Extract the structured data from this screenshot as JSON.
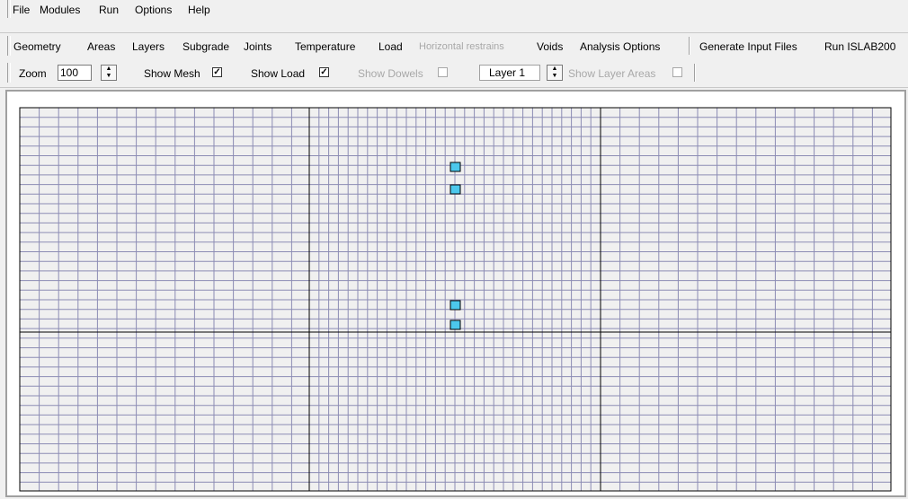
{
  "menu": {
    "items": [
      {
        "label": "File"
      },
      {
        "label": "Modules"
      },
      {
        "label": "Run"
      },
      {
        "label": "Options"
      },
      {
        "label": "Help"
      }
    ]
  },
  "toolbar1": {
    "items": [
      {
        "label": "Geometry",
        "enabled": true
      },
      {
        "label": "Areas",
        "enabled": true
      },
      {
        "label": "Layers",
        "enabled": true
      },
      {
        "label": "Subgrade",
        "enabled": true
      },
      {
        "label": "Joints",
        "enabled": true
      },
      {
        "label": "Temperature",
        "enabled": true
      },
      {
        "label": "Load",
        "enabled": true
      },
      {
        "label": "Horizontal restrains",
        "enabled": false
      },
      {
        "label": "Voids",
        "enabled": true
      },
      {
        "label": "Analysis Options",
        "enabled": true
      }
    ],
    "right_items": [
      {
        "label": "Generate Input Files"
      },
      {
        "label": "Run ISLAB200"
      }
    ]
  },
  "toolbar2": {
    "zoom_label": "Zoom",
    "zoom_value": "100",
    "show_mesh_label": "Show Mesh",
    "show_mesh_checked": true,
    "show_load_label": "Show Load",
    "show_load_checked": true,
    "show_dowels_label": "Show Dowels",
    "show_dowels_enabled": false,
    "layer_value": "Layer 1",
    "show_layer_areas_label": "Show Layer Areas",
    "show_layer_areas_enabled": false
  },
  "mesh": {
    "line_color": "#8c8cb4",
    "slab_line_color": "#000000",
    "load_color": "#4cc8ec",
    "background": "#f0f0f0"
  }
}
